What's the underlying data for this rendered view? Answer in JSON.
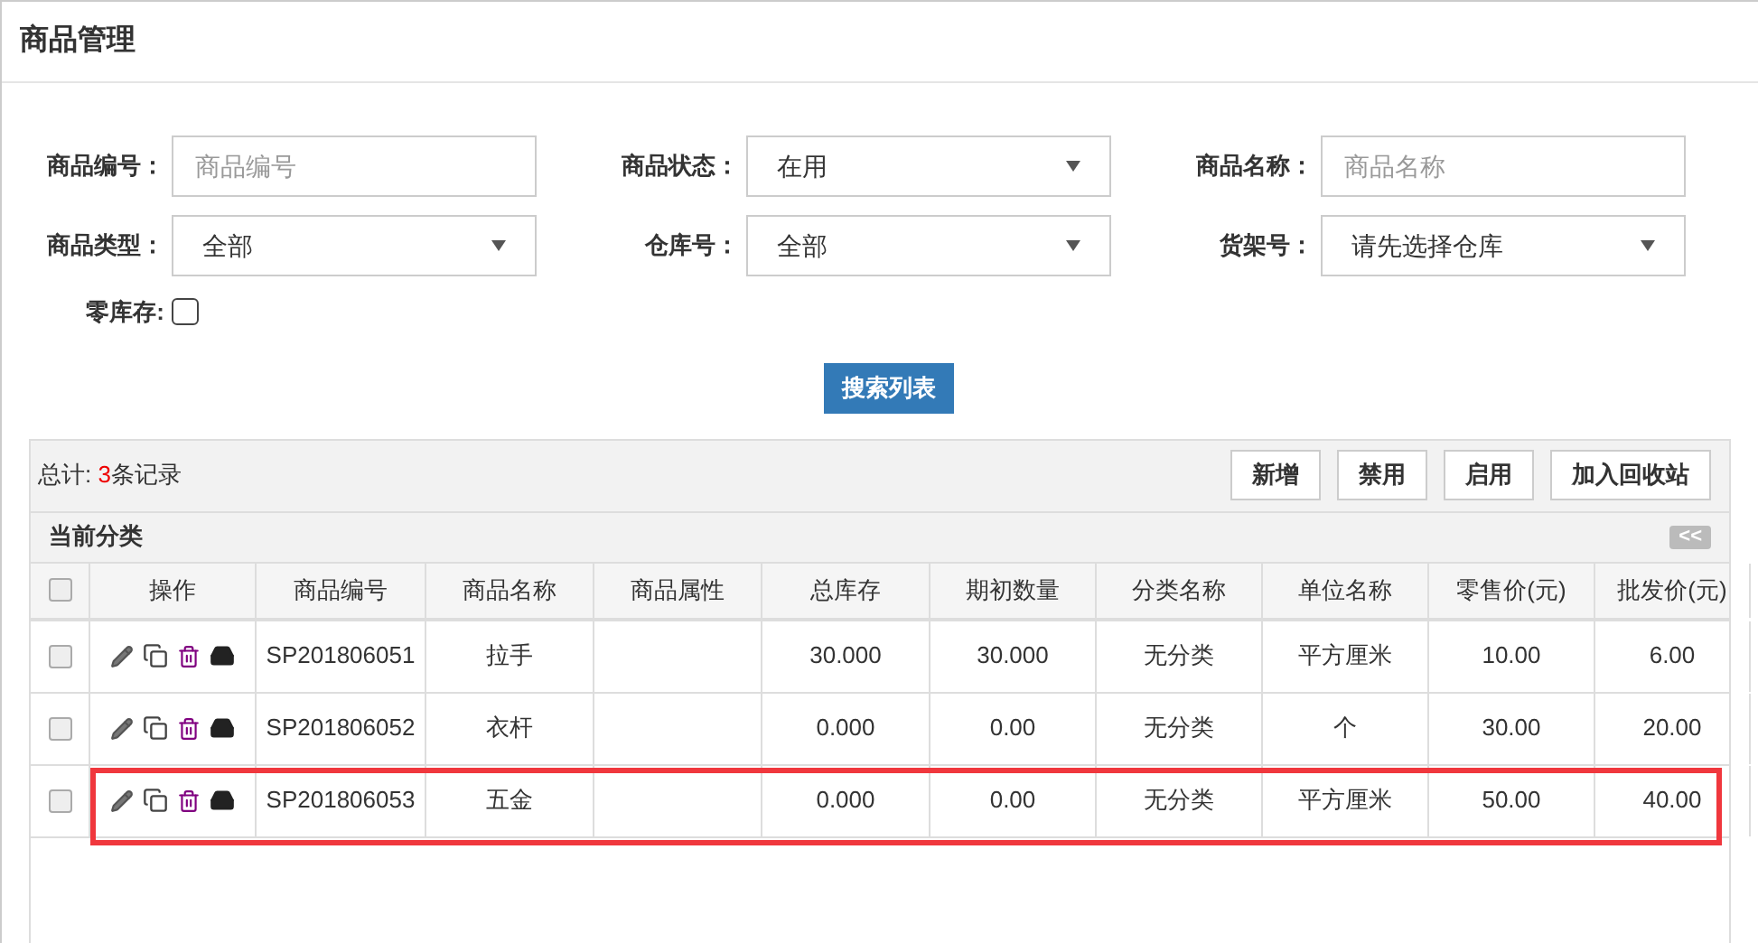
{
  "page_title": "商品管理",
  "filters": [
    {
      "label": "商品编号：",
      "kind": "text",
      "placeholder": "商品编号"
    },
    {
      "label": "商品状态：",
      "kind": "select",
      "value": "在用"
    },
    {
      "label": "商品名称：",
      "kind": "text",
      "placeholder": "商品名称"
    },
    {
      "label": "商品类型：",
      "kind": "select",
      "value": "全部"
    },
    {
      "label": "仓库号：",
      "kind": "select",
      "value": "全部"
    },
    {
      "label": "货架号：",
      "kind": "select",
      "value": "请先选择仓库"
    },
    {
      "label": "零库存:",
      "kind": "checkbox",
      "checked": false
    }
  ],
  "search_button": "搜索列表",
  "summary": {
    "prefix": "总计: ",
    "count": "3",
    "suffix": "条记录"
  },
  "toolbar_buttons": [
    "新增",
    "禁用",
    "启用",
    "加入回收站"
  ],
  "category_bar": {
    "label": "当前分类",
    "collapse": "<<"
  },
  "table": {
    "select_all_checked": false,
    "columns": [
      "操作",
      "商品编号",
      "商品名称",
      "商品属性",
      "总库存",
      "期初数量",
      "分类名称",
      "单位名称",
      "零售价(元)",
      "批发价(元)"
    ],
    "rows": [
      {
        "checked": false,
        "highlighted": false,
        "cells": [
          "",
          "SP201806051",
          "拉手",
          "",
          "30.000",
          "30.000",
          "无分类",
          "平方厘米",
          "10.00",
          "6.00"
        ]
      },
      {
        "checked": false,
        "highlighted": false,
        "cells": [
          "",
          "SP201806052",
          "衣杆",
          "",
          "0.000",
          "0.00",
          "无分类",
          "个",
          "30.00",
          "20.00"
        ]
      },
      {
        "checked": false,
        "highlighted": true,
        "cells": [
          "",
          "SP201806053",
          "五金",
          "",
          "0.000",
          "0.00",
          "无分类",
          "平方厘米",
          "50.00",
          "40.00"
        ]
      }
    ]
  }
}
